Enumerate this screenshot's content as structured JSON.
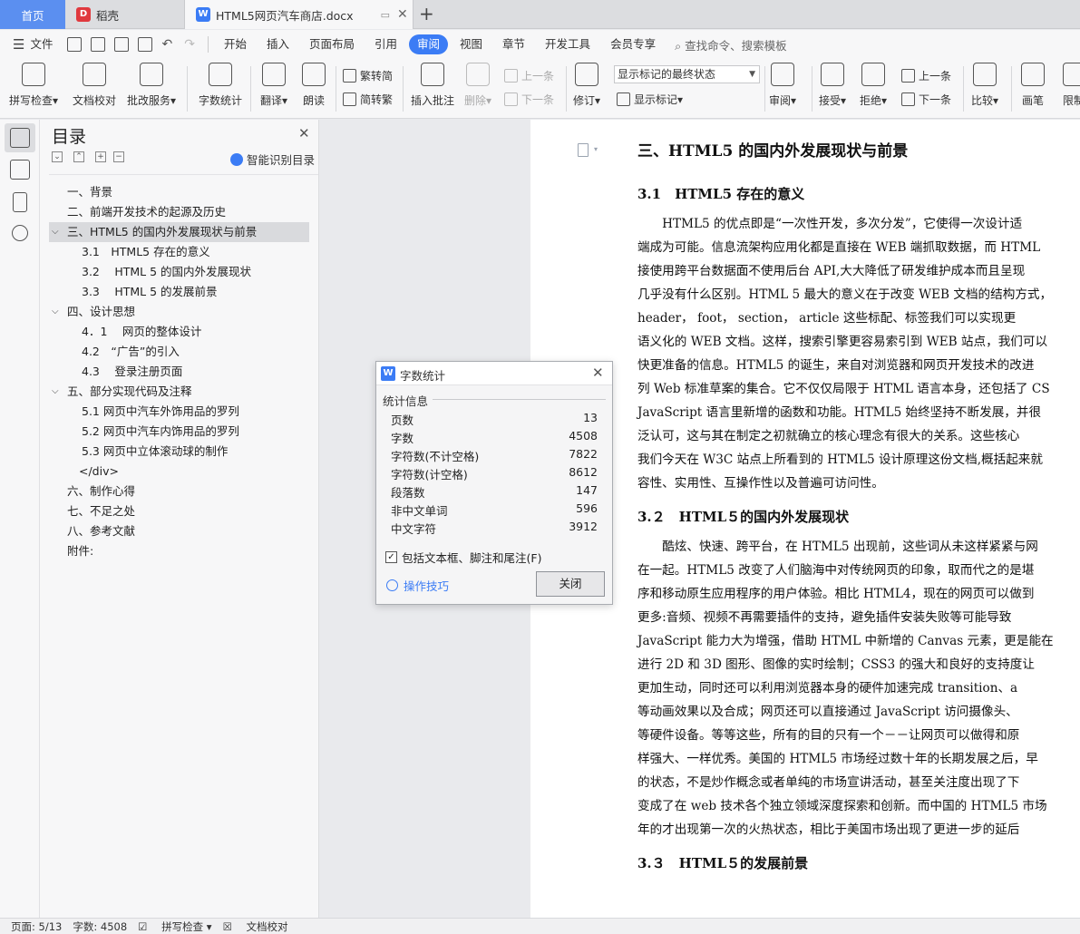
{
  "tabs": {
    "home": "首页",
    "doke": "稻壳",
    "doc": "HTML5网页汽车商店.docx"
  },
  "menu": [
    "文件",
    "开始",
    "插入",
    "页面布局",
    "引用",
    "审阅",
    "视图",
    "章节",
    "开发工具",
    "会员专享"
  ],
  "menu_active": "审阅",
  "search_cmd": "查找命令、搜索模板",
  "ribbon": {
    "spellcheck": "拼写检查",
    "doccheck": "文档校对",
    "review_service": "批改服务",
    "wordcount": "字数统计",
    "translate": "翻译",
    "read_aloud": "朗读",
    "trad_to_simp": "繁转简",
    "simp_to_trad": "简转繁",
    "insert_comment": "插入批注",
    "delete": "删除",
    "prev_comment": "上一条",
    "next_comment": "下一条",
    "track_changes": "修订",
    "track_mode": "显示标记的最终状态",
    "show_markup": "显示标记",
    "review": "审阅",
    "accept": "接受",
    "reject": "拒绝",
    "prev": "上一条",
    "next": "下一条",
    "compare": "比较",
    "pen": "画笔",
    "restrict": "限制"
  },
  "outline": {
    "title": "目录",
    "smart_toc": "智能识别目录",
    "items": [
      {
        "text": "一、背景",
        "level": 1,
        "expander": ""
      },
      {
        "text": "二、前端开发技术的起源及历史",
        "level": 1,
        "expander": ""
      },
      {
        "text": "三、HTML5 的国内外发展现状与前景",
        "level": 1,
        "expander": "⌵",
        "selected": true
      },
      {
        "text": "3.1　HTML5 存在的意义",
        "level": 2,
        "expander": ""
      },
      {
        "text": "3.2　 HTML 5 的国内外发展现状",
        "level": 2,
        "expander": ""
      },
      {
        "text": "3.3　 HTML 5 的发展前景",
        "level": 2,
        "expander": ""
      },
      {
        "text": "四、设计思想",
        "level": 1,
        "expander": "⌵"
      },
      {
        "text": "4．1　 网页的整体设计",
        "level": 2,
        "expander": ""
      },
      {
        "text": "4.2　“广告”的引入",
        "level": 2,
        "expander": ""
      },
      {
        "text": "4.3　 登录注册页面",
        "level": 2,
        "expander": ""
      },
      {
        "text": "五、部分实现代码及注释",
        "level": 1,
        "expander": "⌵"
      },
      {
        "text": "5.1 网页中汽车外饰用品的罗列",
        "level": 2,
        "expander": ""
      },
      {
        "text": "5.2 网页中汽车内饰用品的罗列",
        "level": 2,
        "expander": ""
      },
      {
        "text": "5.3 网页中立体滚动球的制作",
        "level": 2,
        "expander": ""
      },
      {
        "text": "</div>",
        "level": 3,
        "expander": ""
      },
      {
        "text": "六、制作心得",
        "level": 1,
        "expander": ""
      },
      {
        "text": "七、不足之处",
        "level": 1,
        "expander": ""
      },
      {
        "text": "八、参考文献",
        "level": 1,
        "expander": ""
      },
      {
        "text": "附件:",
        "level": 1,
        "expander": ""
      }
    ]
  },
  "doc": {
    "h1": "三、HTML5 的国内外发展现状与前景",
    "s31": "3.1　HTML5 存在的意义",
    "p1": [
      "　　HTML5 的优点即是“一次性开发，多次分发”，它使得一次设计适",
      "端成为可能。信息流架构应用化都是直接在 WEB 端抓取数据，而 HTML",
      "接使用跨平台数据面不使用后台 API,大大降低了研发维护成本而且呈现",
      "几乎没有什么区别。HTML 5 最大的意义在于改变 WEB 文档的结构方式，",
      "header， foot， section， article 这些标配、标签我们可以实现更",
      "语义化的 WEB 文档。这样，搜索引擎更容易索引到 WEB 站点，我们可以",
      "快更准备的信息。HTML5 的诞生，来自对浏览器和网页开发技术的改进",
      "列 Web 标准草案的集合。它不仅仅局限于 HTML 语言本身，还包括了 CS",
      "JavaScript 语言里新增的函数和功能。HTML5 始终坚持不断发展，并很",
      "泛认可，这与其在制定之初就确立的核心理念有很大的关系。这些核心",
      "我们今天在 W3C 站点上所看到的 HTML5 设计原理这份文档,概括起来就",
      "容性、实用性、互操作性以及普遍可访问性。"
    ],
    "s32": "3.２　HTML５的国内外发展现状",
    "p2": [
      "　　酷炫、快速、跨平台，在 HTML5 出现前，这些词从未这样紧紧与网",
      "在一起。HTML5 改变了人们脑海中对传统网页的印象，取而代之的是堪",
      "序和移动原生应用程序的用户体验。相比 HTML4，现在的网页可以做到",
      "更多:音频、视频不再需要插件的支持，避免插件安装失败等可能导致",
      "JavaScript 能力大为增强，借助 HTML 中新增的 Canvas 元素，更是能在",
      "进行 2D 和 3D 图形、图像的实时绘制；CSS3 的强大和良好的支持度让",
      "更加生动，同时还可以利用浏览器本身的硬件加速完成 transition、a",
      "等动画效果以及合成；网页还可以直接通过 JavaScript 访问摄像头、",
      "等硬件设备。等等这些，所有的目的只有一个－－让网页可以做得和原",
      "样强大、一样优秀。美国的 HTML5 市场经过数十年的长期发展之后，早",
      "的状态，不是炒作概念或者单纯的市场宣讲活动，甚至关注度出现了下",
      "变成了在 web 技术各个独立领域深度探索和创新。而中国的 HTML5 市场",
      "年的才出现第一次的火热状态，相比于美国市场出现了更进一步的延后"
    ],
    "s33": "3.３　HTML５的发展前景"
  },
  "status": {
    "page": "页面: 5/13",
    "words": "字数: 4508",
    "spell": "拼写检查",
    "proof": "文档校对"
  },
  "dialog": {
    "title": "字数统计",
    "section": "统计信息",
    "rows": [
      {
        "label": "页数",
        "value": "13"
      },
      {
        "label": "字数",
        "value": "4508"
      },
      {
        "label": "字符数(不计空格)",
        "value": "7822"
      },
      {
        "label": "字符数(计空格)",
        "value": "8612"
      },
      {
        "label": "段落数",
        "value": "147"
      },
      {
        "label": "非中文单词",
        "value": "596"
      },
      {
        "label": "中文字符",
        "value": "3912"
      }
    ],
    "checkbox": "包括文本框、脚注和尾注(F)",
    "tips": "操作技巧",
    "close": "关闭"
  },
  "colors": {
    "accent": "#3b7cf5",
    "home_tab": "#5b8ff0",
    "doke": "#e0393e"
  }
}
